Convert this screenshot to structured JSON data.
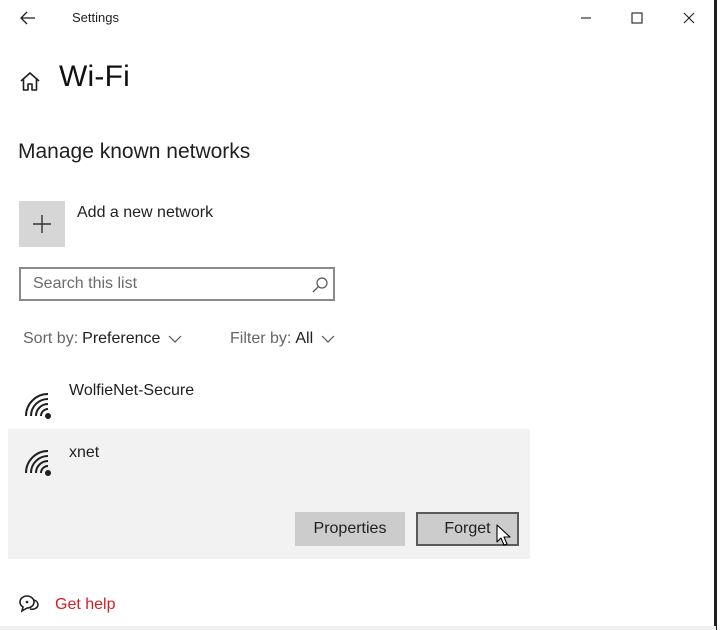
{
  "titlebar": {
    "app_title": "Settings",
    "icons": [
      "back-arrow-icon",
      "minimize-icon",
      "maximize-icon",
      "close-icon"
    ]
  },
  "header": {
    "title": "Wi-Fi",
    "icon": "home-icon"
  },
  "section": {
    "title": "Manage known networks"
  },
  "add_network": {
    "label": "Add a new network",
    "icon": "plus-icon"
  },
  "search": {
    "placeholder": "Search this list",
    "value": "",
    "icon": "search-icon"
  },
  "sort": {
    "label": "Sort by:",
    "value": "Preference"
  },
  "filter": {
    "label": "Filter by:",
    "value": "All"
  },
  "networks": [
    {
      "name": "WolfieNet-Secure",
      "icon": "wifi-secured-icon",
      "selected": false
    },
    {
      "name": "xnet",
      "icon": "wifi-secured-icon",
      "selected": true,
      "actions": {
        "properties": "Properties",
        "forget": "Forget"
      }
    }
  ],
  "help": {
    "label": "Get help",
    "icon": "help-chat-icon"
  },
  "colors": {
    "link_red": "#d21f26",
    "selected_row": "#f2f2f2",
    "button_bg": "#cccccc",
    "tile_bg": "#d6d6d6"
  }
}
